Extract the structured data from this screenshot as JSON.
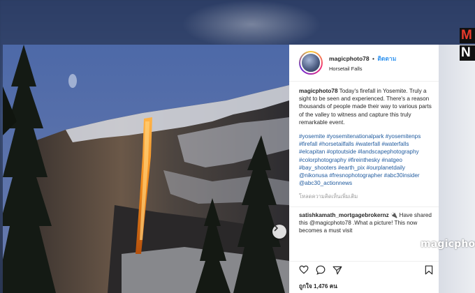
{
  "channel": {
    "logo_top": "M",
    "logo_bottom": "N"
  },
  "post": {
    "username": "magicphoto78",
    "dot": "•",
    "follow_label": "ติดตาม",
    "location": "Horsetail Falls",
    "caption_user": "magicphoto78",
    "caption_text": "Today's firefall in Yosemite. Truly a sight to be seen and experienced. There's a reason thousands of people made their way to various parts of the valley to witness and capture this truly remarkable event.",
    "hashtags": "#yosemite #yosemitenationalpark #yosemitenps #firefall #horsetailfalls #waterfall #waterfalls #elcapitan #optoutside #landscapephotography #colorphotography #fireinthesky #natgeo #bay_shooters #earth_pix #ourplanetdaily @nikonusa #fresnophotographer #abc30insider @abc30_actionnews",
    "translate_label": "โหลดความคิดเห็นเพิ่มเติม",
    "comment_user": "satishkamath_mortgagebrokernz",
    "comment_emoji": "🔌",
    "comment_text": "Have shared this @magicphoto78 .What a picture! This now becomes a must visit",
    "likes": "ถูกใจ 1,476 คน"
  },
  "icons": {
    "like": "heart-icon",
    "comment": "comment-icon",
    "share": "share-icon",
    "save": "bookmark-icon",
    "next": "chevron-right-icon"
  },
  "watermark": "magicphoto",
  "colors": {
    "link_blue": "#3897f0",
    "hashtag_blue": "#1f5a9e",
    "text": "#262626",
    "firefall_orange": "#f08a1c"
  }
}
